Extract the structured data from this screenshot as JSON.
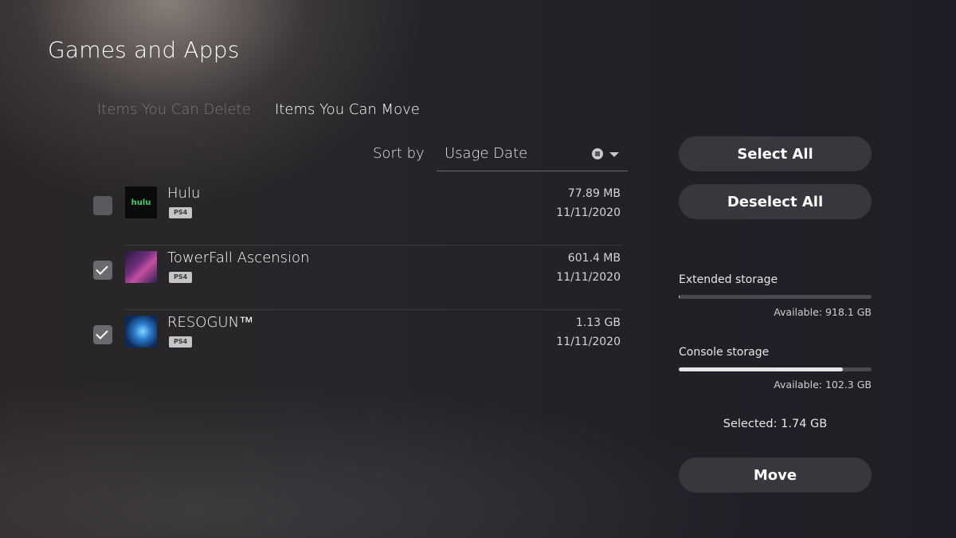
{
  "header": {
    "title": "Games and Apps"
  },
  "tabs": [
    {
      "label": "Items You Can Delete",
      "active": false
    },
    {
      "label": "Items You Can Move",
      "active": true
    }
  ],
  "sort": {
    "label": "Sort by",
    "value": "Usage Date",
    "icons": [
      "circle-square-icon",
      "chevron-down-icon"
    ]
  },
  "items": [
    {
      "title": "Hulu",
      "platform": "PS4",
      "size": "77.89 MB",
      "date": "11/11/2020",
      "checked": false,
      "thumb_logo": "hulu",
      "thumb_color": "#3dd16e"
    },
    {
      "title": "TowerFall Ascension",
      "platform": "PS4",
      "size": "601.4 MB",
      "date": "11/11/2020",
      "checked": true
    },
    {
      "title": "RESOGUN™",
      "platform": "PS4",
      "size": "1.13 GB",
      "date": "11/11/2020",
      "checked": true
    }
  ],
  "actions": {
    "select_all": "Select All",
    "deselect_all": "Deselect All",
    "move": "Move"
  },
  "storage": {
    "extended": {
      "label": "Extended storage",
      "available": "Available: 918.1 GB",
      "used_fraction": 0.005
    },
    "console": {
      "label": "Console storage",
      "available": "Available: 102.3 GB",
      "used_fraction": 0.85
    }
  },
  "selected": "Selected: 1.74 GB",
  "colors": {
    "accent": "#ffffff",
    "button_bg": "#37373d",
    "bar_fill": "#e6e6e6",
    "bar_track": "#4a4a50"
  }
}
